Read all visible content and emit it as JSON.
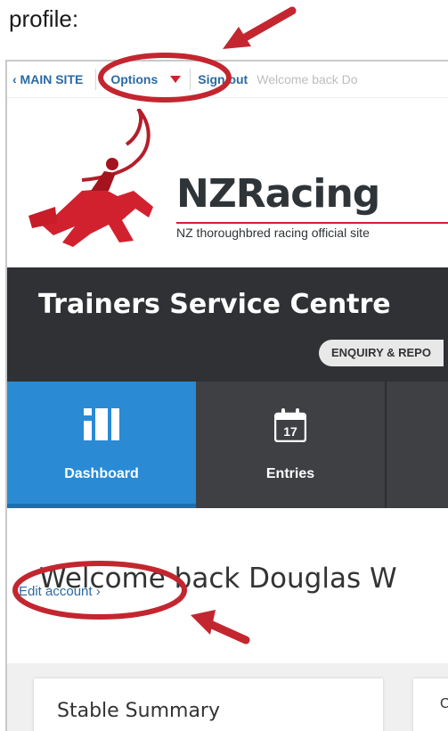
{
  "document": {
    "caption": "profile:"
  },
  "topbar": {
    "main_site": "‹ MAIN SITE",
    "options": "Options",
    "sign_out": "Sign out",
    "welcome_small": "Welcome back Do"
  },
  "brand": {
    "name": "NZRacing",
    "tagline": "NZ thoroughbred racing official site"
  },
  "header": {
    "title": "Trainers Service Centre",
    "enquiry": "ENQUIRY & REPO"
  },
  "nav": {
    "items": [
      {
        "label": "Dashboard",
        "icon": "dashboard-icon"
      },
      {
        "label": "Entries",
        "icon": "calendar-icon",
        "badge": "17"
      }
    ]
  },
  "main": {
    "welcome": "Welcome back Douglas W",
    "edit_account": "Edit account ›"
  },
  "cards": {
    "stable_summary": "Stable Summary",
    "second_card_letter": "C"
  },
  "colors": {
    "accent_blue": "#2a8ad4",
    "annotation_red": "#c3262f",
    "dark_header": "#2f3134",
    "link_blue": "#2a6aa3"
  }
}
